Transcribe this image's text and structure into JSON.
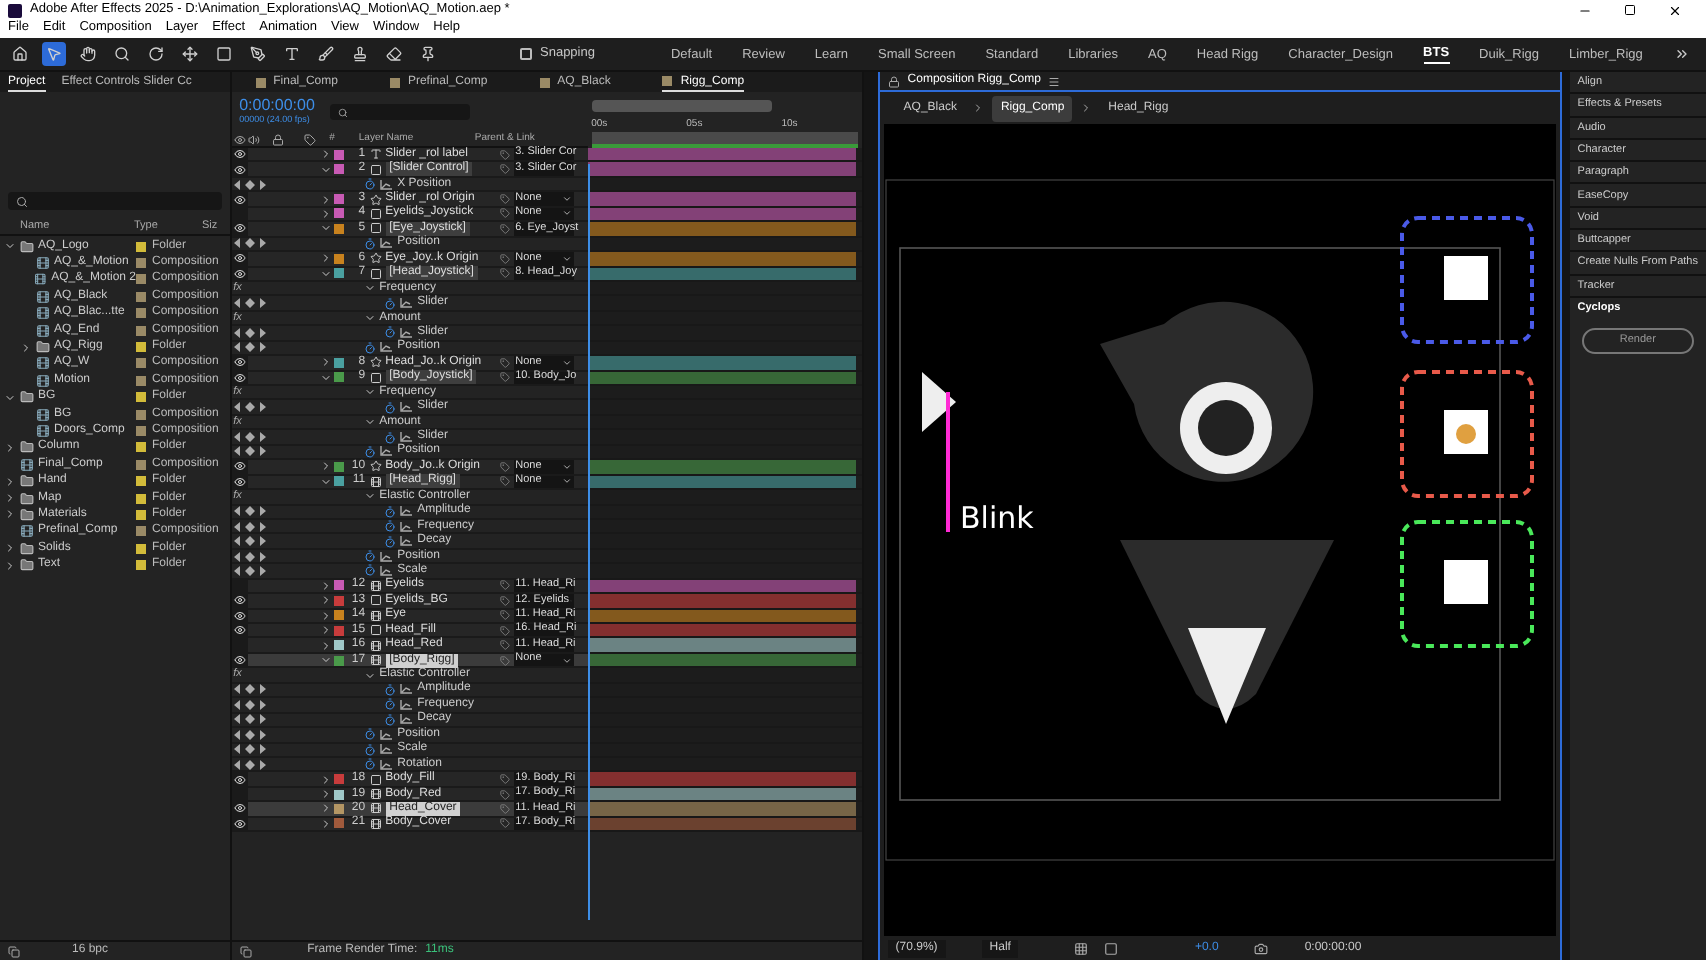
{
  "window": {
    "title": "Adobe After Effects 2025 - D:\\Animation_Explorations\\AQ_Motion\\AQ_Motion.aep *"
  },
  "menu": [
    "File",
    "Edit",
    "Composition",
    "Layer",
    "Effect",
    "Animation",
    "View",
    "Window",
    "Help"
  ],
  "toolbar": {
    "snapping": {
      "label": "Snapping",
      "checked": false
    },
    "workspaces": [
      {
        "label": "Default",
        "selected": false
      },
      {
        "label": "Review",
        "selected": false
      },
      {
        "label": "Learn",
        "selected": false
      },
      {
        "label": "Small Screen",
        "selected": false
      },
      {
        "label": "Standard",
        "selected": false
      },
      {
        "label": "Libraries",
        "selected": false
      },
      {
        "label": "AQ",
        "selected": false
      },
      {
        "label": "Head Rigg",
        "selected": false
      },
      {
        "label": "Character_Design",
        "selected": false
      },
      {
        "label": "BTS",
        "selected": true
      },
      {
        "label": "Duik_Rigg",
        "selected": false
      },
      {
        "label": "Limber_Rigg",
        "selected": false
      }
    ]
  },
  "project": {
    "tabs": [
      {
        "label": "Project",
        "selected": true
      },
      {
        "label": "Effect Controls Slider Cc",
        "selected": false
      }
    ],
    "columns": [
      "Name",
      "Type",
      "Siz"
    ],
    "items": [
      {
        "name": "AQ_Logo",
        "kind": "folder",
        "type": "Folder",
        "expanded": true,
        "children": [
          {
            "name": "AQ_&_Motion",
            "kind": "comp",
            "type": "Composition"
          },
          {
            "name": "AQ_&_Motion 2",
            "kind": "comp",
            "type": "Composition"
          },
          {
            "name": "AQ_Black",
            "kind": "comp",
            "type": "Composition"
          },
          {
            "name": "AQ_Blac...tte",
            "kind": "comp",
            "type": "Composition"
          },
          {
            "name": "AQ_End",
            "kind": "comp",
            "type": "Composition"
          },
          {
            "name": "AQ_Rigg",
            "kind": "folder",
            "type": "Folder",
            "expanded": false
          },
          {
            "name": "AQ_W",
            "kind": "comp",
            "type": "Composition"
          },
          {
            "name": "Motion",
            "kind": "comp",
            "type": "Composition"
          }
        ]
      },
      {
        "name": "BG",
        "kind": "folder",
        "type": "Folder",
        "expanded": true,
        "children": [
          {
            "name": "BG",
            "kind": "comp",
            "type": "Composition"
          },
          {
            "name": "Doors_Comp",
            "kind": "comp",
            "type": "Composition"
          }
        ]
      },
      {
        "name": "Column",
        "kind": "folder",
        "type": "Folder",
        "expanded": false
      },
      {
        "name": "Final_Comp",
        "kind": "comp",
        "type": "Composition"
      },
      {
        "name": "Hand",
        "kind": "folder",
        "type": "Folder",
        "expanded": false
      },
      {
        "name": "Map",
        "kind": "folder",
        "type": "Folder",
        "expanded": false
      },
      {
        "name": "Materials",
        "kind": "folder",
        "type": "Folder",
        "expanded": false
      },
      {
        "name": "Prefinal_Comp",
        "kind": "comp",
        "type": "Composition"
      },
      {
        "name": "Solids",
        "kind": "folder",
        "type": "Folder",
        "expanded": false
      },
      {
        "name": "Text",
        "kind": "folder",
        "type": "Folder",
        "expanded": false
      }
    ],
    "bit_depth": "16 bpc"
  },
  "timeline": {
    "tabs": [
      {
        "label": "Final_Comp",
        "selected": false
      },
      {
        "label": "Prefinal_Comp",
        "selected": false
      },
      {
        "label": "AQ_Black",
        "selected": false
      },
      {
        "label": "Rigg_Comp",
        "selected": true
      }
    ],
    "timecode": "0:00:00:00",
    "frame_info": "00000 (24.00 fps)",
    "columns": [
      "#",
      "Layer Name",
      "Parent & Link"
    ],
    "ruler": [
      "00s",
      "05s",
      "10s"
    ],
    "layers": [
      {
        "number": "1",
        "name": "Slider _rol label",
        "kind": "text",
        "color": "#c85ab4",
        "parent": "3. Slider Cor",
        "visible": true,
        "expanded": false,
        "boxed": false,
        "selected": false
      },
      {
        "number": "2",
        "name": "[Slider Control]",
        "kind": "solid",
        "color": "#c85ab4",
        "parent": "3. Slider Cor",
        "visible": true,
        "expanded": true,
        "boxed": true,
        "selected": false,
        "children": [
          {
            "kind": "property",
            "name": "X Position"
          }
        ]
      },
      {
        "number": "3",
        "name": "Slider _rol Origin",
        "kind": "shape",
        "color": "#c85ab4",
        "parent": "None",
        "visible": true,
        "expanded": false,
        "boxed": false,
        "selected": false
      },
      {
        "number": "4",
        "name": "Eyelids_Joystick",
        "kind": "solid",
        "color": "#c85ab4",
        "parent": "None",
        "visible": false,
        "expanded": false,
        "boxed": false,
        "selected": false
      },
      {
        "number": "5",
        "name": "[Eye_Joystick]",
        "kind": "solid",
        "color": "#c8821e",
        "parent": "6. Eye_Joyst",
        "visible": true,
        "expanded": true,
        "boxed": true,
        "selected": false,
        "children": [
          {
            "kind": "property",
            "name": "Position"
          }
        ]
      },
      {
        "number": "6",
        "name": "Eye_Joy..k Origin",
        "kind": "shape",
        "color": "#c8821e",
        "parent": "None",
        "visible": true,
        "expanded": false,
        "boxed": false,
        "selected": false
      },
      {
        "number": "7",
        "name": "[Head_Joystick]",
        "kind": "solid",
        "color": "#4aa0a0",
        "parent": "8. Head_Joy",
        "visible": true,
        "expanded": true,
        "boxed": true,
        "selected": false,
        "children": [
          {
            "kind": "group",
            "name": "Frequency",
            "fx": "fx",
            "children": [
              {
                "kind": "property",
                "name": "Slider"
              }
            ]
          },
          {
            "kind": "group",
            "name": "Amount",
            "fx": "fx",
            "children": [
              {
                "kind": "property",
                "name": "Slider"
              }
            ]
          },
          {
            "kind": "property",
            "name": "Position"
          }
        ]
      },
      {
        "number": "8",
        "name": "Head_Jo..k Origin",
        "kind": "shape",
        "color": "#4aa0a0",
        "parent": "None",
        "visible": true,
        "expanded": false,
        "boxed": false,
        "selected": false
      },
      {
        "number": "9",
        "name": "[Body_Joystick]",
        "kind": "solid",
        "color": "#4a9a4a",
        "parent": "10. Body_Jo",
        "visible": true,
        "expanded": true,
        "boxed": true,
        "selected": false,
        "children": [
          {
            "kind": "group",
            "name": "Frequency",
            "fx": "fx",
            "children": [
              {
                "kind": "property",
                "name": "Slider"
              }
            ]
          },
          {
            "kind": "group",
            "name": "Amount",
            "fx": "fx",
            "children": [
              {
                "kind": "property",
                "name": "Slider"
              }
            ]
          },
          {
            "kind": "property",
            "name": "Position"
          }
        ]
      },
      {
        "number": "10",
        "name": "Body_Jo..k Origin",
        "kind": "shape",
        "color": "#4a9a4a",
        "parent": "None",
        "visible": true,
        "expanded": false,
        "boxed": false,
        "selected": false
      },
      {
        "number": "11",
        "name": "[Head_Rigg]",
        "kind": "comp",
        "color": "#4aa0a0",
        "parent": "None",
        "visible": true,
        "expanded": true,
        "boxed": true,
        "selected": false,
        "children": [
          {
            "kind": "group",
            "name": "Elastic Controller",
            "fx": "fx",
            "children": [
              {
                "kind": "property",
                "name": "Amplitude"
              },
              {
                "kind": "property",
                "name": "Frequency"
              },
              {
                "kind": "property",
                "name": "Decay"
              }
            ]
          },
          {
            "kind": "property",
            "name": "Position"
          },
          {
            "kind": "property",
            "name": "Scale"
          }
        ]
      },
      {
        "number": "12",
        "name": "Eyelids",
        "kind": "comp",
        "color": "#c85ab4",
        "parent": "11. Head_Ri",
        "visible": false,
        "expanded": false,
        "boxed": false,
        "selected": false
      },
      {
        "number": "13",
        "name": "Eyelids_BG",
        "kind": "solid",
        "color": "#c83c3c",
        "parent": "12. Eyelids",
        "visible": true,
        "expanded": false,
        "boxed": false,
        "selected": false
      },
      {
        "number": "14",
        "name": "Eye",
        "kind": "comp",
        "color": "#c8821e",
        "parent": "11. Head_Ri",
        "visible": true,
        "expanded": false,
        "boxed": false,
        "selected": false
      },
      {
        "number": "15",
        "name": "Head_Fill",
        "kind": "solid",
        "color": "#c83c3c",
        "parent": "16. Head_Ri",
        "visible": true,
        "expanded": false,
        "boxed": false,
        "selected": false
      },
      {
        "number": "16",
        "name": "Head_Red",
        "kind": "comp",
        "color": "#a0c8c8",
        "parent": "11. Head_Ri",
        "visible": false,
        "expanded": false,
        "boxed": false,
        "selected": false
      },
      {
        "number": "17",
        "name": "[Body_Rigg]",
        "kind": "comp",
        "color": "#4a9a4a",
        "parent": "None",
        "visible": true,
        "expanded": true,
        "boxed": true,
        "selected": true,
        "children": [
          {
            "kind": "group",
            "name": "Elastic Controller",
            "fx": "fx",
            "children": [
              {
                "kind": "property",
                "name": "Amplitude"
              },
              {
                "kind": "property",
                "name": "Frequency"
              },
              {
                "kind": "property",
                "name": "Decay"
              }
            ]
          },
          {
            "kind": "property",
            "name": "Position"
          },
          {
            "kind": "property",
            "name": "Scale"
          },
          {
            "kind": "property",
            "name": "Rotation"
          }
        ]
      },
      {
        "number": "18",
        "name": "Body_Fill",
        "kind": "solid",
        "color": "#c83c3c",
        "parent": "19. Body_Ri",
        "visible": true,
        "expanded": false,
        "boxed": false,
        "selected": false
      },
      {
        "number": "19",
        "name": "Body_Red",
        "kind": "comp",
        "color": "#a0c8c8",
        "parent": "17. Body_Ri",
        "visible": false,
        "expanded": false,
        "boxed": false,
        "selected": false
      },
      {
        "number": "20",
        "name": "Head_Cover",
        "kind": "comp",
        "color": "#b49664",
        "parent": "11. Head_Ri",
        "visible": true,
        "expanded": false,
        "boxed": true,
        "selected": true
      },
      {
        "number": "21",
        "name": "Body_Cover",
        "kind": "comp",
        "color": "#a05a3c",
        "parent": "17. Body_Ri",
        "visible": true,
        "expanded": false,
        "boxed": false,
        "selected": false
      }
    ],
    "render_label": "Frame Render Time:",
    "render_time": "11ms"
  },
  "viewer": {
    "tab": "Composition Rigg_Comp",
    "breadcrumbs": [
      {
        "label": "AQ_Black",
        "selected": false
      },
      {
        "label": "Rigg_Comp",
        "selected": true
      },
      {
        "label": "Head_Rigg",
        "selected": false
      }
    ],
    "canvas_label": "Blink",
    "zoom": "(70.9%)",
    "resolution": "Half",
    "exposure": "+0.0",
    "timecode": "0:00:00:00"
  },
  "panels": {
    "items": [
      "Align",
      "Effects & Presets",
      "Audio",
      "Character",
      "Paragraph",
      "EaseCopy",
      "Void",
      "Buttcapper",
      "Create Nulls From Paths",
      "Tracker"
    ],
    "cyclops": "Cyclops",
    "render_button": "Render"
  }
}
